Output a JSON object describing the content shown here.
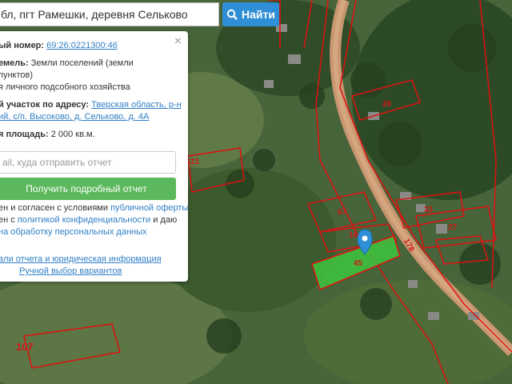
{
  "search": {
    "value": "бл, пгт Рамешки, деревня Сельково",
    "button_label": "Найти"
  },
  "panel": {
    "close": "×",
    "cadastral_label": "ый номер:",
    "cadastral_value": "69:26:0221300:46",
    "category_label": "емель:",
    "category_value_1": "Земли поселений (земли",
    "category_value_2": "пунктов)",
    "usage": "я личного подсобного хозяйства",
    "address_label": "й участок по адресу:",
    "address_1": "Тверская область, р-н",
    "address_2": "ий, с/п. Высоково, д. Сельково, д. 4А",
    "area_label": "я площадь:",
    "area_value": "2 000 кв.м.",
    "email_placeholder": "ail, куда отправить отчет",
    "report_button": "Получить подробный отчет",
    "terms_1a": "ен и согласен с условиями",
    "terms_1b": "публичной оферты",
    "terms_2a": "ен с",
    "terms_2b": "политикой конфиденциальности",
    "terms_2c": "и даю",
    "terms_3": "на обработку персональных данных",
    "link_details": "али отчета и юридическая информация",
    "link_manual": "Ручной выбор вариантов"
  },
  "map": {
    "plot_numbers": [
      "26",
      "21",
      "67",
      "33",
      "27",
      "16",
      "45",
      "178",
      "107"
    ],
    "selected_plot": "45",
    "colors": {
      "boundary": "#e01010",
      "selected_fill": "#3ec43e",
      "marker": "#2f8fd6",
      "road": "#c89670"
    }
  }
}
